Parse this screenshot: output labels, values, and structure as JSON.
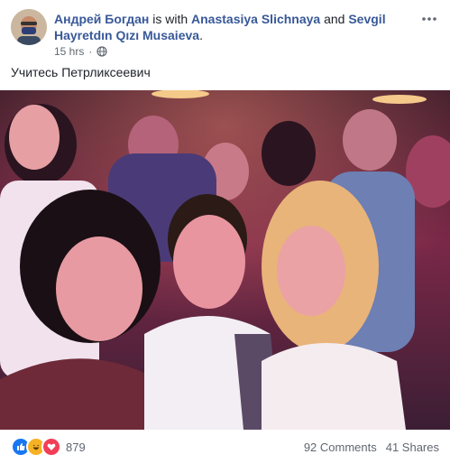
{
  "post": {
    "author": "Андрей Богдан",
    "with_text": " is with ",
    "tagged_1": "Anastasiya Slichnaya",
    "and_text": " and ",
    "tagged_2": "Sevgil Hayretdın Qızı Musaieva",
    "period": ".",
    "time": "15 hrs",
    "separator": "·",
    "caption": "Учитесь Петрликсеевич",
    "privacy_icon": "globe-icon"
  },
  "footer": {
    "reaction_count": "879",
    "comments": "92 Comments",
    "shares": "41 Shares",
    "reaction_icons": [
      "like-icon",
      "haha-icon",
      "love-icon"
    ]
  },
  "colors": {
    "link": "#385898",
    "like": "#1877f2",
    "haha": "#f7b125",
    "love": "#f33e58"
  }
}
